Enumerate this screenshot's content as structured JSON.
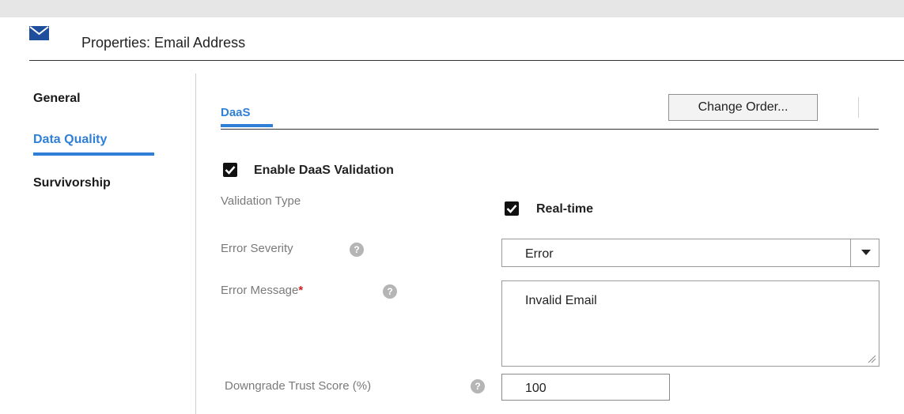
{
  "header": {
    "title": "Properties: Email Address",
    "icon": "envelope-icon"
  },
  "sidebar": {
    "items": [
      {
        "label": "General",
        "active": false
      },
      {
        "label": "Data Quality",
        "active": true
      },
      {
        "label": "Survivorship",
        "active": false
      }
    ]
  },
  "tabs": {
    "active_label": "DaaS"
  },
  "toolbar": {
    "change_order_label": "Change Order..."
  },
  "form": {
    "enable_daas": {
      "label": "Enable DaaS Validation",
      "checked": true
    },
    "validation_type": {
      "label": "Validation Type",
      "option_label": "Real-time",
      "checked": true
    },
    "error_severity": {
      "label": "Error Severity",
      "value": "Error"
    },
    "error_message": {
      "label": "Error Message",
      "required_mark": "*",
      "value": "Invalid Email"
    },
    "downgrade_trust": {
      "label": "Downgrade Trust Score (%)",
      "value": "100"
    },
    "help_glyph": "?"
  },
  "colors": {
    "accent": "#2f7fd6",
    "icon": "#1f4e9c",
    "required": "#d02020"
  }
}
